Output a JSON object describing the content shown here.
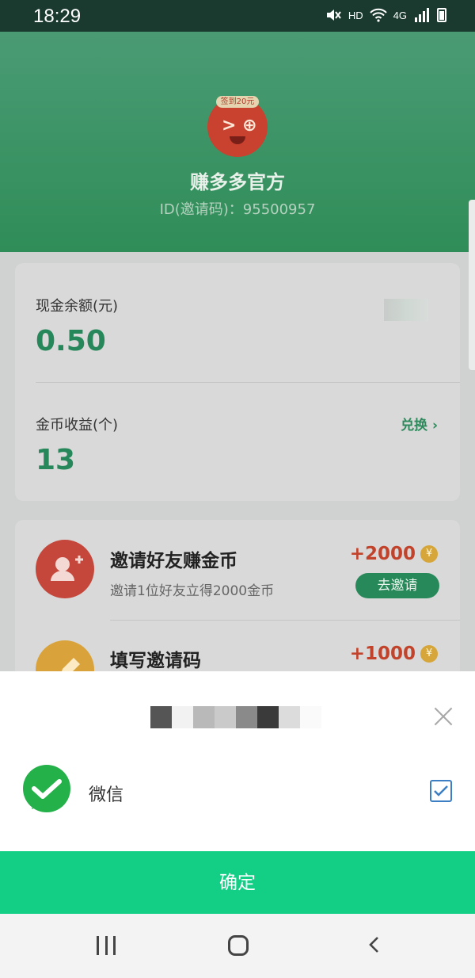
{
  "status_bar": {
    "time": "18:29",
    "indicators": [
      "mute-icon",
      "HD",
      "wifi-icon",
      "4G",
      "signal-icon",
      "battery-icon"
    ],
    "hd": "HD",
    "net": "4G"
  },
  "profile": {
    "avatar_badge": "签到20元",
    "name": "赚多多官方",
    "id_text": "ID(邀请码)：95500957"
  },
  "balance": {
    "cash_label": "现金余额(元)",
    "cash_value": "0.50",
    "coins_label": "金币收益(个)",
    "coins_value": "13",
    "exchange_label": "兑换 ›"
  },
  "tasks": [
    {
      "title": "邀请好友赚金币",
      "subtitle": "邀请1位好友立得2000金币",
      "reward": "+2000",
      "button": "去邀请",
      "icon": "add-user-icon",
      "color": "#c5473c"
    },
    {
      "title": "填写邀请码",
      "reward": "+1000",
      "icon": "pencil-icon",
      "color": "#d9a23a"
    }
  ],
  "coin_symbol": "¥",
  "share_sheet": {
    "option_label": "微信",
    "option_checked": true,
    "confirm_label": "确定"
  },
  "colors": {
    "accent_green": "#12cf85",
    "header_green": "#3b9466",
    "reward_red": "#c2432c"
  }
}
